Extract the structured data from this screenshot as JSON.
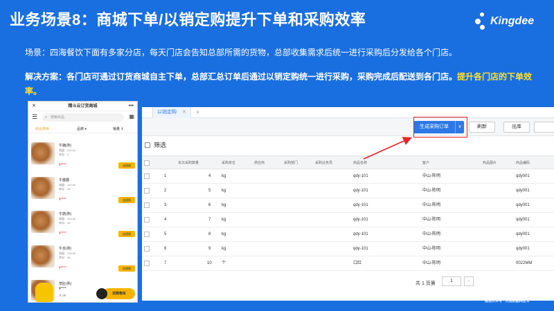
{
  "title": "业务场景8：商城下单/以销定购提升下单和采购效率",
  "logo": {
    "text": "Kingdee",
    "icon": "kingdee-dots-icon"
  },
  "description": "场景：四海餐饮下面有多家分店，每天门店会告知总部所需的货物，总部收集需求后统一进行采购后分发给各个门店。",
  "solution": {
    "text": "解决方案：各门店可通过订货商城自主下单，总部汇总订单后通过以销定购统一进行采购，采购完成后配送到各门店。",
    "highlight": "提升各门店的下单效率。"
  },
  "phone": {
    "title": "精斗云订货商城",
    "search_placeholder": "搜索商品",
    "tabs": [
      "综合排序",
      "品牌 ▾",
      "销量 ⇕"
    ],
    "products": [
      {
        "name": "牛腩(熟)",
        "sales": "销量：220.00",
        "stock": "库存：4",
        "price": "¥****",
        "button": "选规格"
      },
      {
        "name": "牛腱腱",
        "sales": "销量：120.00",
        "stock": "库存：46",
        "price": "¥****",
        "button": "选规格"
      },
      {
        "name": "牛筋(熟)",
        "sales": "销量：103.00",
        "stock": "库存：42",
        "price": "¥****",
        "button": "选规格"
      },
      {
        "name": "牛舌(熟)",
        "sales": "销量：100.00",
        "stock": "库存：45",
        "price": "¥****",
        "button": "选规格"
      }
    ],
    "cart": {
      "name": "草肚(熟)",
      "price": "¥****",
      "count": "共1种",
      "button": "去购物车"
    }
  },
  "app": {
    "tab_label": "以销定购",
    "toolbar": {
      "generate": "生成采购订单",
      "refresh": "刷新",
      "outbound": "出库"
    },
    "filter_label": "筛选",
    "columns": [
      "本次采购数量",
      "采购单位",
      "供应商",
      "采购部门",
      "采购业务员",
      "商品名称",
      "客户",
      "商品图片",
      "商品编码"
    ],
    "rows": [
      {
        "no": "1",
        "qty": "4",
        "unit": "kg",
        "product": "qdy-101",
        "customer": "中山-陈明",
        "code": "qdy001"
      },
      {
        "no": "2",
        "qty": "5",
        "unit": "kg",
        "product": "qdy-101",
        "customer": "中山-陈明",
        "code": "qdy001"
      },
      {
        "no": "3",
        "qty": "6",
        "unit": "kg",
        "product": "qdy-101",
        "customer": "中山-陈明",
        "code": "qdy001"
      },
      {
        "no": "4",
        "qty": "7",
        "unit": "kg",
        "product": "qdy-101",
        "customer": "中山-陈明",
        "code": "qdy001"
      },
      {
        "no": "5",
        "qty": "8",
        "unit": "kg",
        "product": "qdy-101",
        "customer": "中山-陈明",
        "code": "qdy001"
      },
      {
        "no": "6",
        "qty": "9",
        "unit": "kg",
        "product": "qdy-101",
        "customer": "中山-陈明",
        "code": "qdy001"
      },
      {
        "no": "7",
        "qty": "10",
        "unit": "个",
        "product": "口红",
        "customer": "中山-陈明",
        "code": "0022MM"
      }
    ],
    "pager": {
      "total": "共 1 页第",
      "page": "1",
      "suffix": "页"
    }
  },
  "watermark": {
    "brand": "火煜",
    "small": "微信公众号 · 火煜数据科技"
  },
  "page_number": "1"
}
